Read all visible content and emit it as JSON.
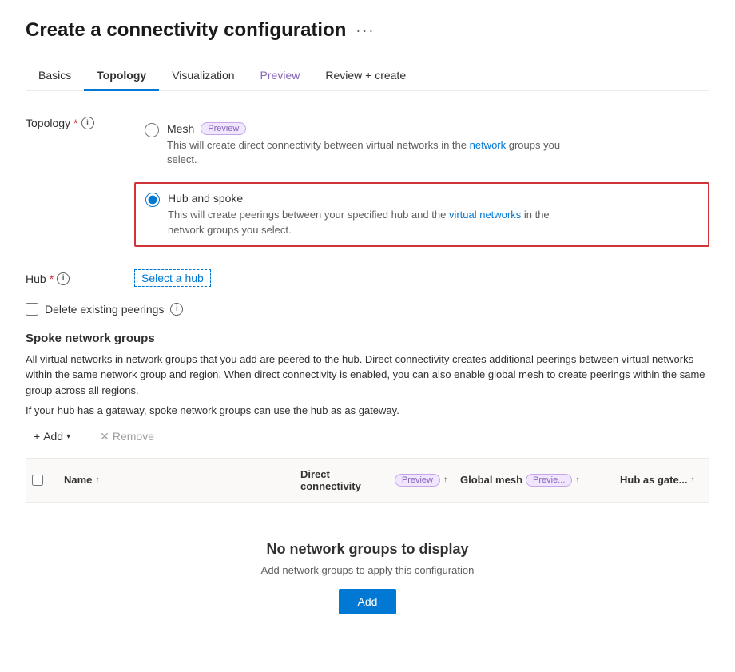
{
  "page": {
    "title": "Create a connectivity configuration",
    "more_options_icon": "···"
  },
  "tabs": [
    {
      "id": "basics",
      "label": "Basics",
      "active": false,
      "preview": false
    },
    {
      "id": "topology",
      "label": "Topology",
      "active": true,
      "preview": false
    },
    {
      "id": "visualization",
      "label": "Visualization",
      "active": false,
      "preview": false
    },
    {
      "id": "preview",
      "label": "Preview",
      "active": false,
      "preview": true
    },
    {
      "id": "review-create",
      "label": "Review + create",
      "active": false,
      "preview": false
    }
  ],
  "topology_field": {
    "label": "Topology",
    "required": true,
    "info": "i",
    "options": [
      {
        "id": "mesh",
        "label": "Mesh",
        "preview": true,
        "preview_label": "Preview",
        "description": "This will create direct connectivity between virtual networks in the network groups you select.",
        "selected": false
      },
      {
        "id": "hub-spoke",
        "label": "Hub and spoke",
        "preview": false,
        "description": "This will create peerings between your specified hub and the virtual networks in the network groups you select.",
        "selected": true
      }
    ]
  },
  "hub_field": {
    "label": "Hub",
    "required": true,
    "info": "i",
    "select_link": "Select a hub"
  },
  "delete_peerings": {
    "label": "Delete existing peerings",
    "info": "i",
    "checked": false
  },
  "spoke_section": {
    "title": "Spoke network groups",
    "description1": "All virtual networks in network groups that you add are peered to the hub. Direct connectivity creates additional peerings between virtual networks within the same network group and region. When direct connectivity is enabled, you can also enable global mesh to create peerings within the same group across all regions.",
    "description2": "If your hub has a gateway, spoke network groups can use the hub as as gateway."
  },
  "toolbar": {
    "add_label": "Add",
    "remove_label": "Remove"
  },
  "table": {
    "headers": [
      {
        "id": "checkbox",
        "label": ""
      },
      {
        "id": "name",
        "label": "Name",
        "sort": true
      },
      {
        "id": "direct-connectivity",
        "label": "Direct connectivity",
        "preview": true,
        "sort": true
      },
      {
        "id": "global-mesh",
        "label": "Global mesh",
        "preview_short": "Previe...",
        "sort": true
      },
      {
        "id": "hub-as-gate",
        "label": "Hub as gate...",
        "sort": true
      }
    ],
    "empty_state": {
      "title": "No network groups to display",
      "description": "Add network groups to apply this configuration",
      "add_button": "Add"
    }
  }
}
